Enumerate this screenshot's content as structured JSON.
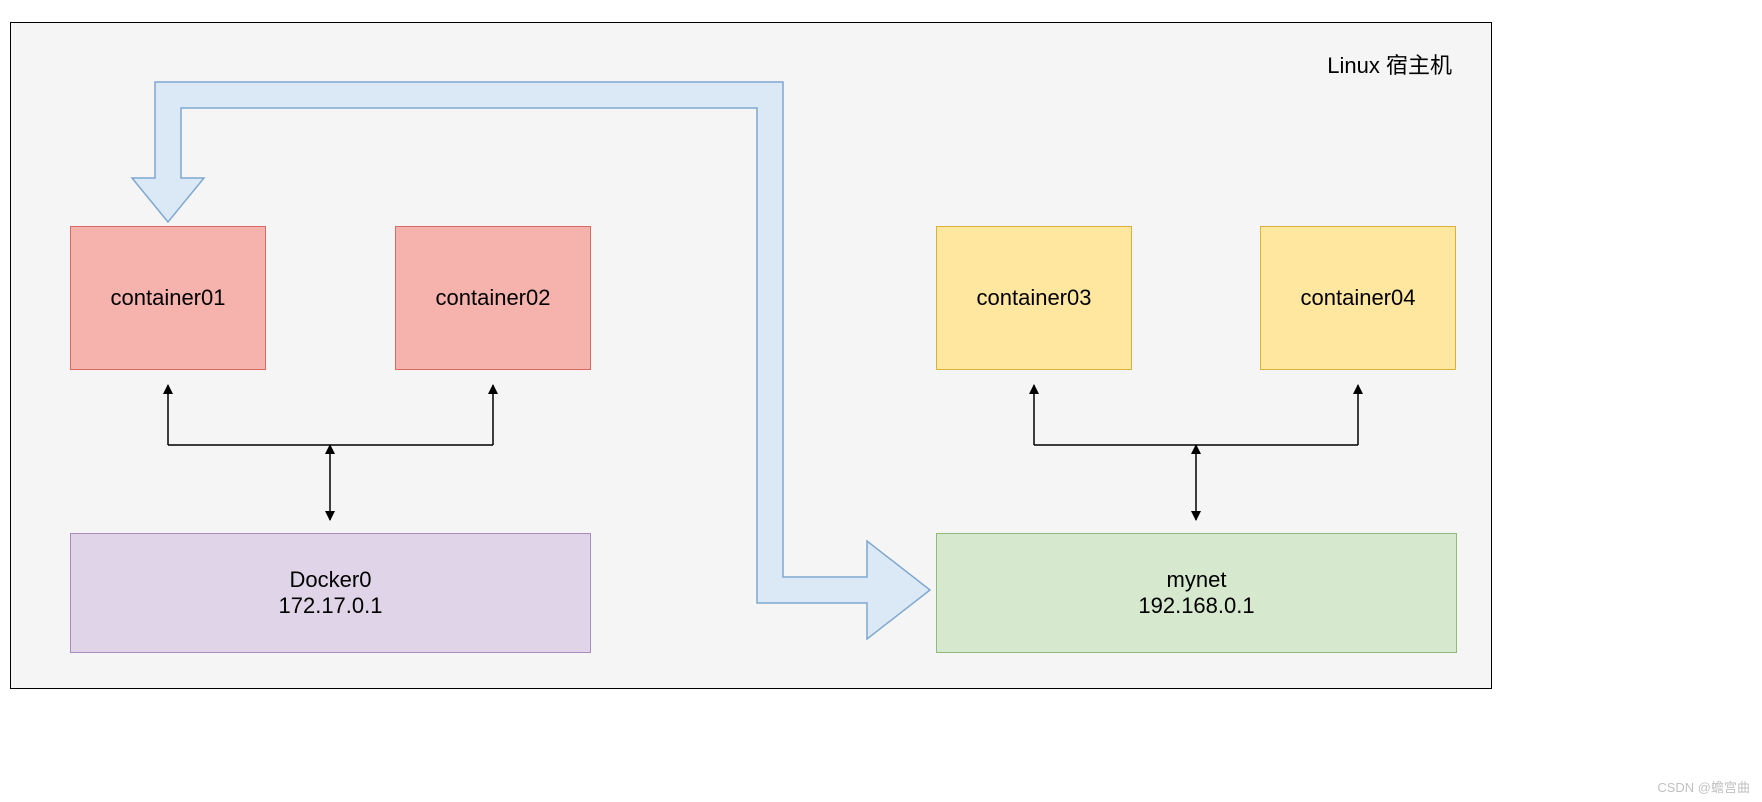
{
  "host_label": "Linux 宿主机",
  "containers": {
    "c1": "container01",
    "c2": "container02",
    "c3": "container03",
    "c4": "container04"
  },
  "networks": {
    "left_name": "Docker0",
    "left_ip": "172.17.0.1",
    "right_name": "mynet",
    "right_ip": "192.168.0.1"
  },
  "watermark": "CSDN @蟾宫曲",
  "colors": {
    "red_fill": "#f6b2ad",
    "red_stroke": "#d96a5f",
    "yellow_fill": "#ffe79f",
    "yellow_stroke": "#d9b13b",
    "purple_fill": "#e0d5e8",
    "purple_stroke": "#a98bbd",
    "green_fill": "#d6e8ce",
    "green_stroke": "#8fbb7a",
    "blue_fill": "#dbe9f6",
    "blue_stroke": "#7fa8d0",
    "frame_bg": "#f5f5f5"
  }
}
